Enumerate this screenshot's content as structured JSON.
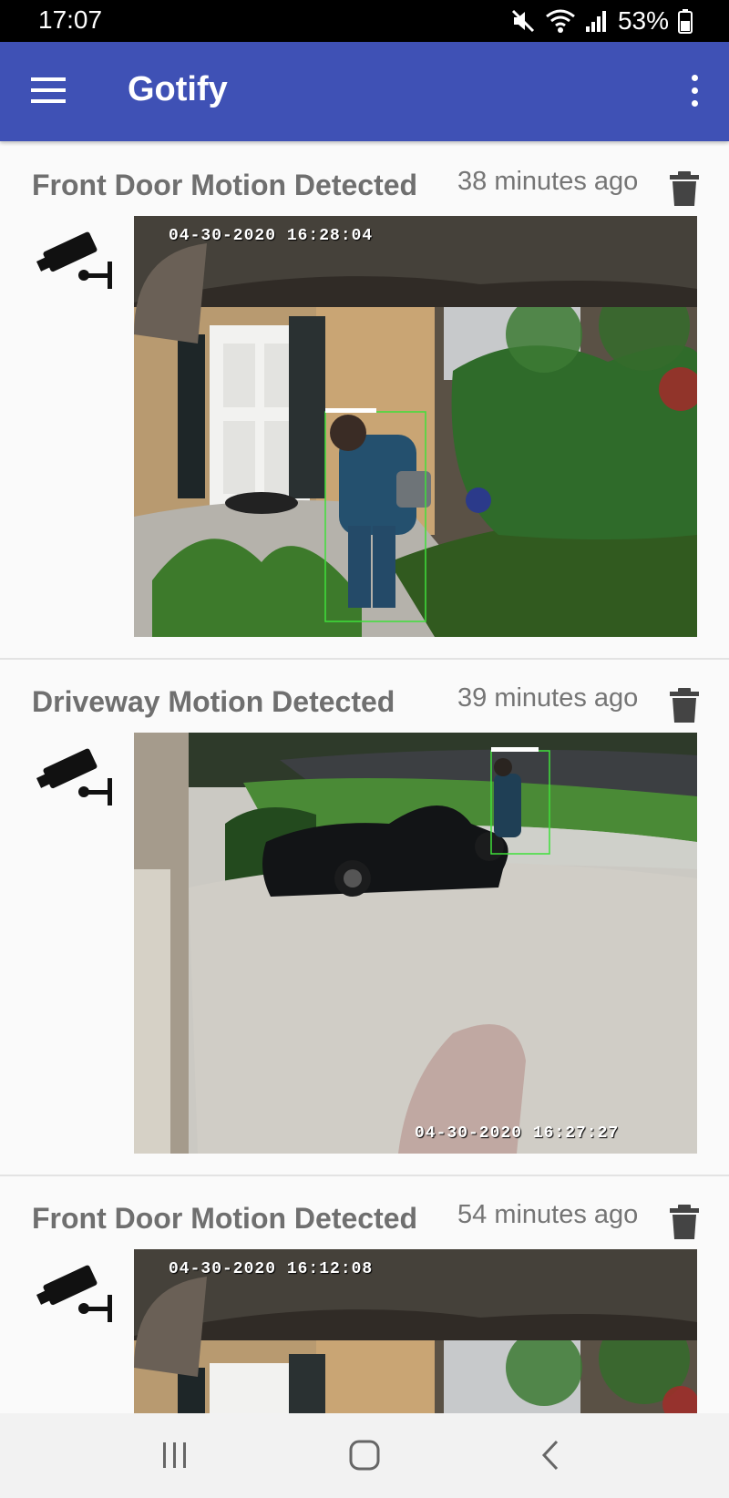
{
  "status_bar": {
    "time": "17:07",
    "battery": "53%",
    "icons": [
      "mute-icon",
      "wifi-icon",
      "signal-icon",
      "battery-icon"
    ]
  },
  "app_bar": {
    "title": "Gotify",
    "color": "#3f51b5"
  },
  "messages": [
    {
      "title": "Front Door Motion Detected",
      "date": "38 minutes ago",
      "image_timestamp": "04-30-2020 16:28:04",
      "icon": "cctv-camera-icon"
    },
    {
      "title": "Driveway Motion Detected",
      "date": "39 minutes ago",
      "image_timestamp": "04-30-2020 16:27:27",
      "icon": "cctv-camera-icon"
    },
    {
      "title": "Front Door Motion Detected",
      "date": "54 minutes ago",
      "image_timestamp": "04-30-2020 16:12:08",
      "icon": "cctv-camera-icon"
    }
  ],
  "nav_bar": {
    "buttons": [
      "recents-icon",
      "home-icon",
      "back-icon"
    ]
  }
}
